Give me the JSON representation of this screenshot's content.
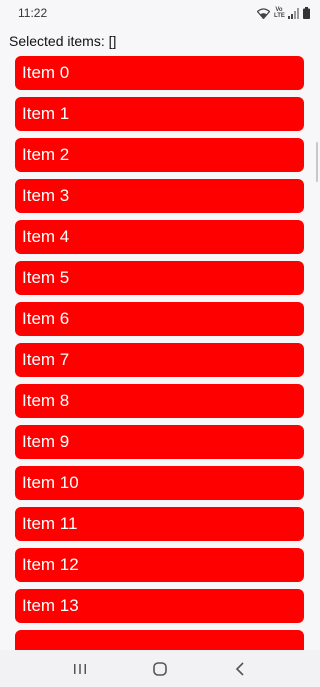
{
  "status_bar": {
    "time": "11:22",
    "volte_label": "Vo LTE",
    "icons": [
      "wifi-icon",
      "volte-icon",
      "signal-icon",
      "battery-icon"
    ]
  },
  "header": {
    "selected_text": "Selected items: []"
  },
  "list": {
    "items": [
      {
        "label": "Item 0"
      },
      {
        "label": "Item 1"
      },
      {
        "label": "Item 2"
      },
      {
        "label": "Item 3"
      },
      {
        "label": "Item 4"
      },
      {
        "label": "Item 5"
      },
      {
        "label": "Item 6"
      },
      {
        "label": "Item 7"
      },
      {
        "label": "Item 8"
      },
      {
        "label": "Item 9"
      },
      {
        "label": "Item 10"
      },
      {
        "label": "Item 11"
      },
      {
        "label": "Item 12"
      },
      {
        "label": "Item 13"
      },
      {
        "label": ""
      }
    ],
    "item_color": "#ff0000"
  },
  "nav_bar": {
    "buttons": [
      "recents-icon",
      "home-icon",
      "back-icon"
    ]
  }
}
